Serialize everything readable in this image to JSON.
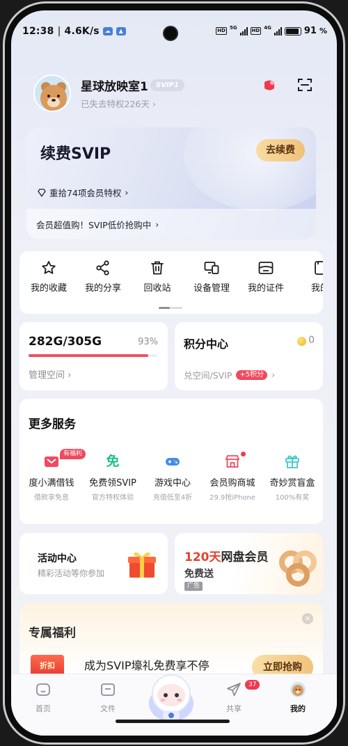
{
  "status_bar": {
    "time": "12:38",
    "net_speed": "4.6K/s",
    "net_5g": "5G",
    "net_4g": "4G",
    "battery": "91"
  },
  "profile": {
    "username": "星球放映室1",
    "vip_tag": "SVIP1",
    "privilege_lost": "已失去特权226天"
  },
  "svip_card": {
    "title": "续费SVIP",
    "renew_button": "去续费",
    "restore_text": "重拾74项会员特权",
    "deal_text": "会员超值购！SVIP低价抢购中"
  },
  "quick_actions": [
    {
      "label": "我的收藏",
      "icon": "star-icon"
    },
    {
      "label": "我的分享",
      "icon": "share-icon"
    },
    {
      "label": "回收站",
      "icon": "trash-icon"
    },
    {
      "label": "设备管理",
      "icon": "devices-icon"
    },
    {
      "label": "我的证件",
      "icon": "id-card-icon"
    },
    {
      "label": "我的",
      "icon": "card-icon"
    }
  ],
  "storage": {
    "used": "282G/305G",
    "percent_label": "93%",
    "percent": 0.93,
    "manage_link": "管理空间"
  },
  "points": {
    "title": "积分中心",
    "value": "0",
    "sub_text": "兑空间/SVIP",
    "badge": "+5积分"
  },
  "services": {
    "title": "更多服务",
    "welfare_badge": "有福利",
    "items": [
      {
        "name": "度小满借钱",
        "sub": "借款享免息",
        "icon": "loan-icon",
        "color": "#ef4a5f"
      },
      {
        "name": "免费领SVIP",
        "sub": "官方特权体验",
        "icon": "free-icon",
        "color": "#20c08a"
      },
      {
        "name": "游戏中心",
        "sub": "充值低至4折",
        "icon": "gamepad-icon",
        "color": "#3d8ff2"
      },
      {
        "name": "会员购商城",
        "sub": "29.9抢iPhone",
        "icon": "shop-icon",
        "color": "#ef4a5f"
      },
      {
        "name": "奇妙赏盲盒",
        "sub": "100%有奖",
        "icon": "blindbox-icon",
        "color": "#3ec9c9"
      }
    ]
  },
  "activity": {
    "title": "活动中心",
    "sub": "精彩活动等你参加"
  },
  "ad": {
    "title_highlight": "120天",
    "title_rest": "网盘会员",
    "sub": "免费送",
    "tag": "广告"
  },
  "exclusive": {
    "title": "专属福利",
    "close": "×",
    "thumb_text": "折扣",
    "promo_text": "成为SVIP壕礼免费享不停",
    "button": "立即抢购"
  },
  "tabs": [
    {
      "label": "首页",
      "icon": "home-icon",
      "active": false
    },
    {
      "label": "文件",
      "icon": "folder-icon",
      "active": false
    },
    {
      "label": "共享",
      "icon": "send-icon",
      "active": false,
      "badge": "37"
    },
    {
      "label": "我的",
      "icon": "avatar-icon",
      "active": true
    }
  ],
  "colors": {
    "accent_red": "#ef4a5f",
    "gold_button": "#f0c179",
    "progress_red": "#ef5060"
  }
}
